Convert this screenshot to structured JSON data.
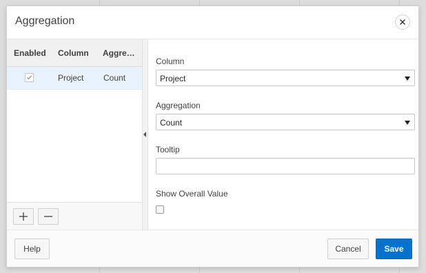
{
  "dialog": {
    "title": "Aggregation",
    "close_icon": "close-icon"
  },
  "grid": {
    "columns": [
      "Enabled",
      "Column",
      "Aggre…"
    ],
    "rows": [
      {
        "enabled": true,
        "column": "Project",
        "aggregation": "Count"
      }
    ],
    "add_icon": "plus-icon",
    "remove_icon": "minus-icon"
  },
  "form": {
    "column_label": "Column",
    "column_value": "Project",
    "aggregation_label": "Aggregation",
    "aggregation_value": "Count",
    "tooltip_label": "Tooltip",
    "tooltip_value": "",
    "show_overall_label": "Show Overall Value",
    "show_overall_checked": false
  },
  "footer": {
    "help_label": "Help",
    "cancel_label": "Cancel",
    "save_label": "Save"
  },
  "colors": {
    "primary": "#0572ce",
    "selected_row": "#e8f2fc"
  }
}
